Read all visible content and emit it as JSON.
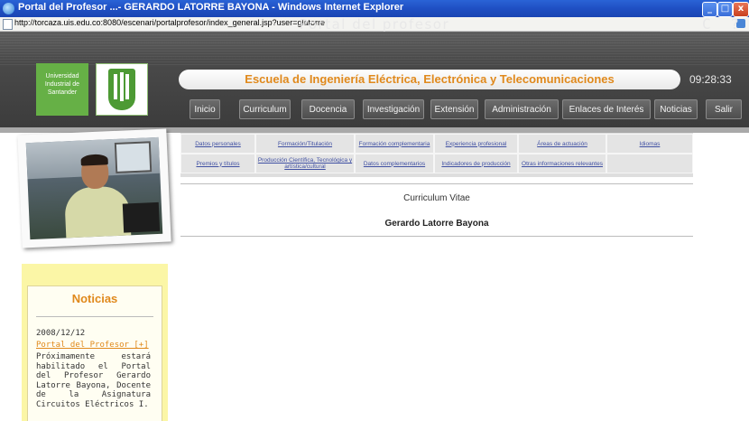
{
  "browser": {
    "title": "Portal del Profesor ...- GERARDO LATORRE BAYONA - Windows Internet Explorer",
    "url": "http://torcaza.uis.edu.co:8080/escenari/portalprofesor/index_general.jsp?user=glatorre",
    "buttons": {
      "minimize": "_",
      "maximize": "□",
      "close": "x"
    }
  },
  "header": {
    "portal_title": "Portal del profesor",
    "top_icons": "C ? X",
    "logo_text": "Universidad Industrial de Santander",
    "school_name": "Escuela de Ingeniería Eléctrica, Electrónica y Telecomunicaciones",
    "clock": "09:28:33"
  },
  "nav": {
    "items": [
      {
        "label": "Inicio"
      },
      {
        "label": "Curriculum"
      },
      {
        "label": "Docencia"
      },
      {
        "label": "Investigación"
      },
      {
        "label": "Extensión"
      },
      {
        "label": "Administración"
      },
      {
        "label": "Enlaces de Interés"
      },
      {
        "label": "Noticias"
      },
      {
        "label": "Salir"
      }
    ]
  },
  "tabs": {
    "row1": [
      {
        "label": "Datos personales"
      },
      {
        "label": "Formación/Titulación"
      },
      {
        "label": "Formación complementaria"
      },
      {
        "label": "Experiencia profesional"
      },
      {
        "label": "Áreas de actuación"
      },
      {
        "label": "Idiomas"
      }
    ],
    "row2": [
      {
        "label": "Premios y títulos"
      },
      {
        "label": "Producción Científica, Tecnológica y artística/cultural"
      },
      {
        "label": "Datos complementarios"
      },
      {
        "label": "Indicadores de producción"
      },
      {
        "label": "Otras informaciones relevantes"
      }
    ]
  },
  "cv": {
    "title": "Curriculum Vitae",
    "name": "Gerardo Latorre Bayona"
  },
  "news": {
    "title": "Noticias",
    "date": "2008/12/12",
    "link": "Portal del Profesor [+]",
    "body": "Próximamente estará habilitado el Portal del Profesor Gerardo Latorre Bayona, Docente de la Asignatura Circuitos Eléctricos I."
  },
  "colors": {
    "accent_orange": "#e0891c",
    "uis_green": "#66b046",
    "header_gray": "#4a4a4a",
    "link_blue": "#3f4fa2"
  }
}
